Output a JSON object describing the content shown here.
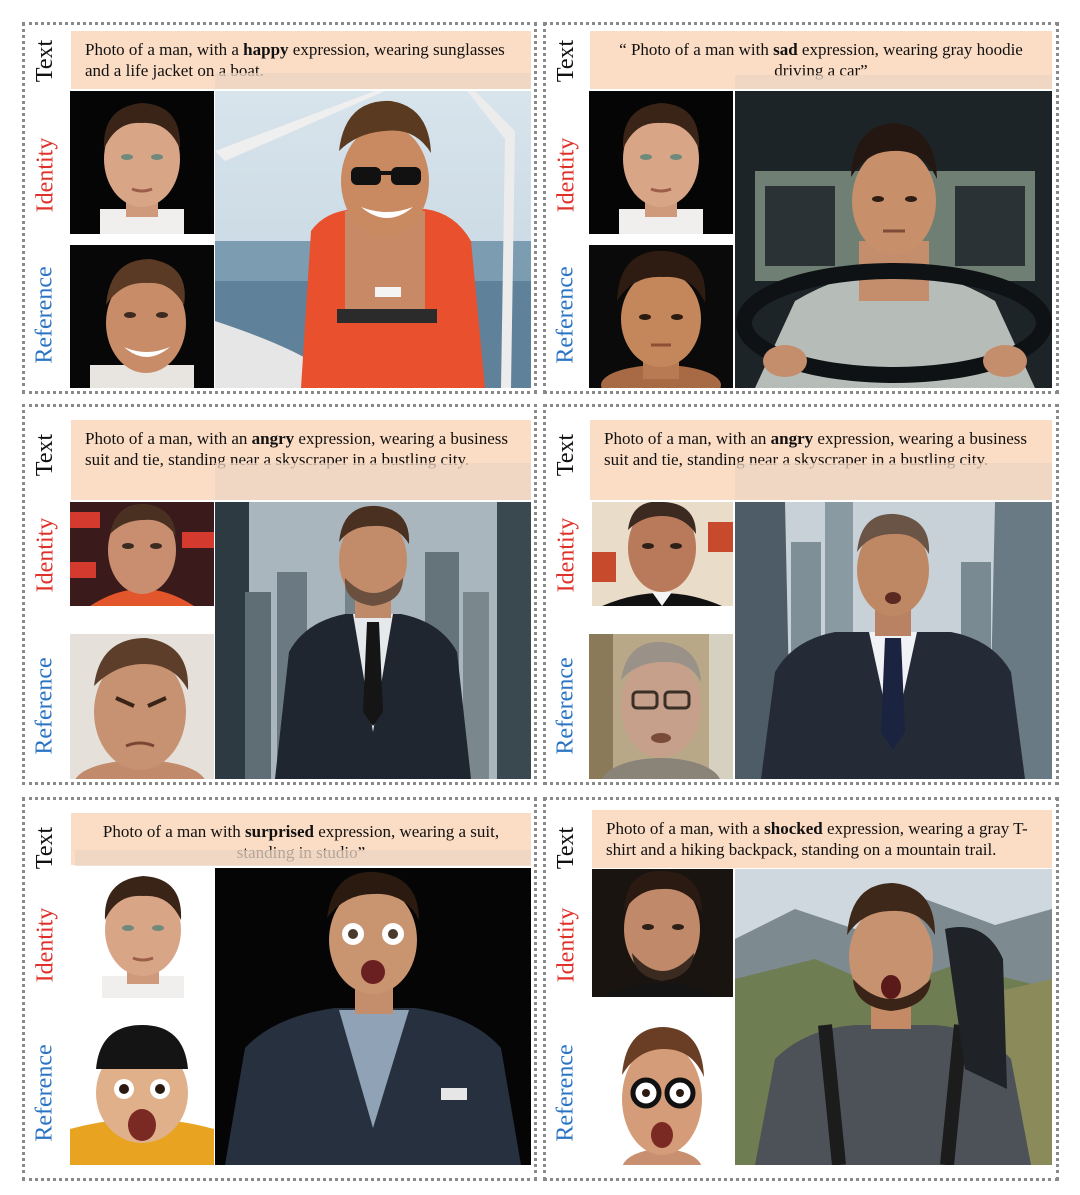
{
  "labels": {
    "text": "Text",
    "identity": "Identity",
    "reference": "Reference"
  },
  "panels": [
    {
      "caption_pre": "Photo of  a man, with a ",
      "caption_bold": "happy",
      "caption_post": " expression, wearing sunglasses and a life jacket on a boat."
    },
    {
      "caption_pre": "“ Photo of  a man with ",
      "caption_bold": "sad",
      "caption_post": " expression, wearing gray hoodie driving a car”"
    },
    {
      "caption_pre": "Photo of a man, with an ",
      "caption_bold": "angry",
      "caption_post": " expression, wearing a business suit and tie, standing near a skyscraper in a bustling city."
    },
    {
      "caption_pre": "Photo of a man, with an ",
      "caption_bold": "angry",
      "caption_post": " expression, wearing a business suit and tie, standing near a skyscraper in a bustling city."
    },
    {
      "caption_pre": "Photo of  a man with ",
      "caption_bold": "surprised",
      "caption_post": " expression, wearing a suit, standing in studio”"
    },
    {
      "caption_pre": "Photo of a man, with a ",
      "caption_bold": "shocked",
      "caption_post": " expression, wearing a gray T-shirt and a hiking backpack, standing on a mountain trail."
    }
  ],
  "colors": {
    "identity_label": "#e0302a",
    "reference_label": "#2a74c4",
    "caption_bg": "#fbdcc4",
    "border": "#8a8a8a"
  }
}
